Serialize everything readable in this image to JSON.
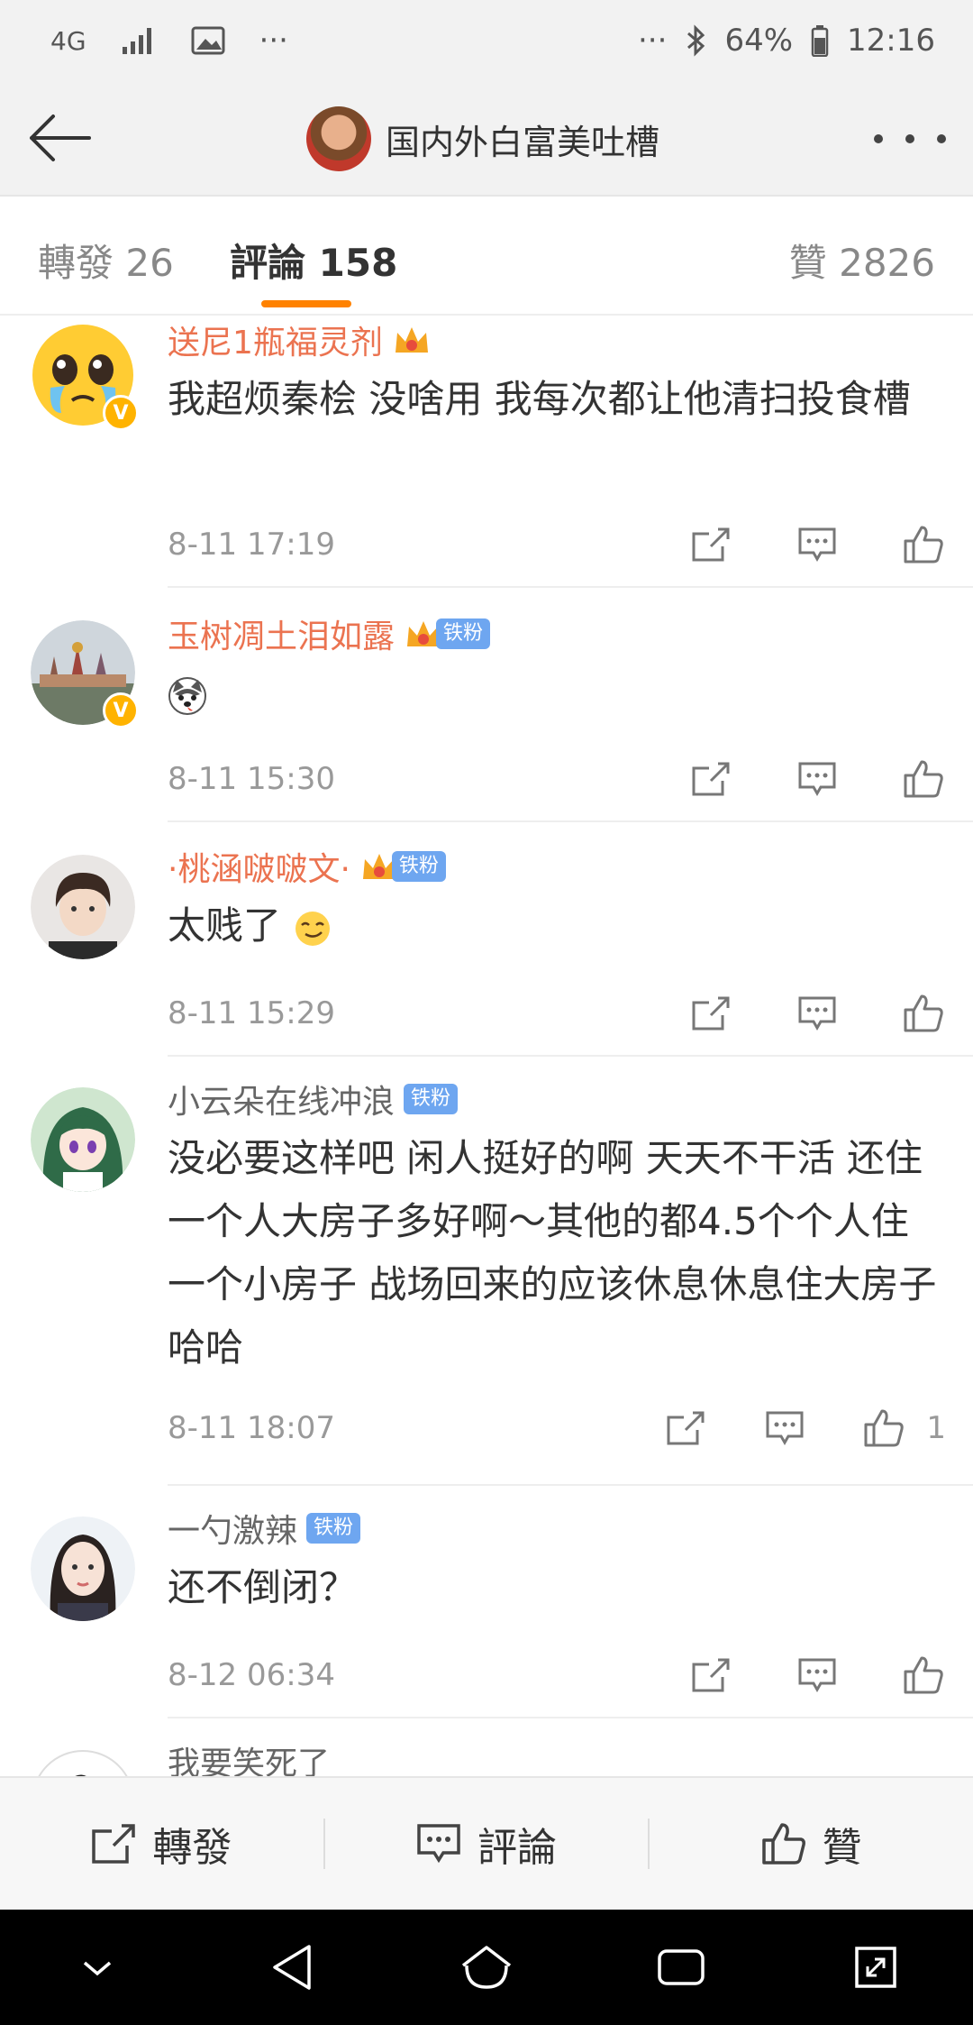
{
  "status_bar": {
    "network": "4G",
    "more": "···",
    "battery": "64%",
    "time": "12:16"
  },
  "header": {
    "title": "国内外白富美吐槽"
  },
  "tabs": {
    "reposts": "轉發 26",
    "comments": "評論 158",
    "likes": "贊 2826"
  },
  "comments": [
    {
      "name": "送尼1瓶福灵剂",
      "name_color": "orange",
      "badge": "",
      "text": "我超烦秦桧 没啥用 我每次都让他清扫投食槽",
      "time": "8-11 17:19",
      "likes": ""
    },
    {
      "name": "玉树凋土泪如露",
      "name_color": "orange",
      "badge": "铁粉",
      "text": "",
      "time": "8-11 15:30",
      "likes": ""
    },
    {
      "name": "·桃涵啵啵文·",
      "name_color": "orange",
      "badge": "铁粉",
      "text": "太贱了",
      "time": "8-11 15:29",
      "likes": ""
    },
    {
      "name": "小云朵在线冲浪",
      "name_color": "gray",
      "badge": "铁粉",
      "text": "没必要这样吧  闲人挺好的啊   天天不干活 还住一个人大房子多好啊～其他的都4.5个个人住一个小房子  战场回来的应该休息休息住大房子哈哈",
      "time": "8-11 18:07",
      "likes": "1"
    },
    {
      "name": "一勺激辣",
      "name_color": "gray",
      "badge": "铁粉",
      "text": "还不倒闭？",
      "time": "8-12 06:34",
      "likes": ""
    },
    {
      "name": "我要笑死了",
      "name_color": "gray",
      "badge": "",
      "text": "",
      "time": "",
      "likes": ""
    }
  ],
  "bottom_bar": {
    "repost": "轉發",
    "comment": "評論",
    "like": "贊"
  },
  "icons": {
    "accent": "#ff8200",
    "name_orange": "#eb7350",
    "fan_badge": "#6ea6f0"
  }
}
